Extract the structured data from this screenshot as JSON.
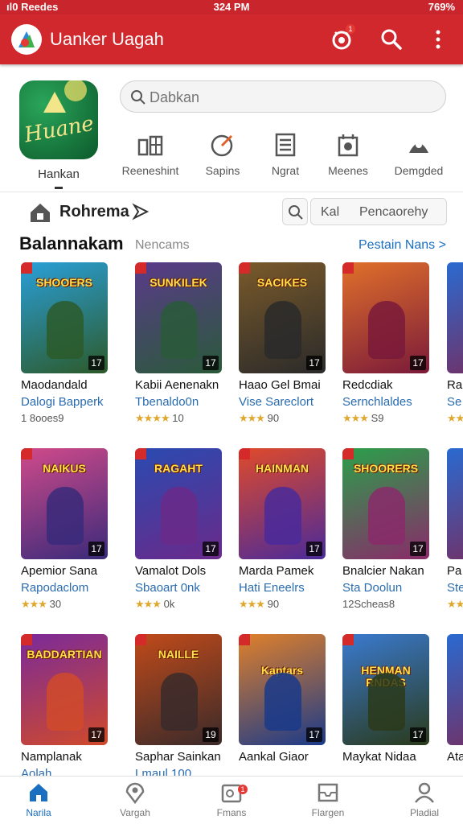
{
  "status_bar": {
    "left": "ıl0 Reedes",
    "time": "324 PM",
    "battery": "769%"
  },
  "app_bar": {
    "title": "Uanker Uagah",
    "notif_count": "1"
  },
  "featured": {
    "label": "Hankan",
    "icon_text": "Huane"
  },
  "search": {
    "placeholder": "Dabkan"
  },
  "categories": [
    {
      "label": "Reeneshint",
      "icon": "grid-book-icon"
    },
    {
      "label": "Sapins",
      "icon": "target-icon"
    },
    {
      "label": "Ngrat",
      "icon": "list-doc-icon"
    },
    {
      "label": "Meenes",
      "icon": "puzzle-icon"
    },
    {
      "label": "Demgded",
      "icon": "robot-icon"
    }
  ],
  "section": {
    "name": "Rohrema",
    "filter_a": "Kal",
    "filter_b": "Pencaorehy"
  },
  "list": {
    "title": "Balannakam",
    "subtitle": "Nencams",
    "link": "Pestain Nans >"
  },
  "games": [
    {
      "title": "Maodandald",
      "publisher": "Dalogi Bapperk",
      "rating": "1 8ooes9",
      "stars": "",
      "art_title": "SHOOERS",
      "age": "17",
      "c1": "#2a9fd8",
      "c2": "#2c5a2a"
    },
    {
      "title": "Kabii Aenenakn",
      "publisher": "Tbenaldo0n",
      "rating": "10",
      "stars": "★★★★",
      "art_title": "SUNKILEK",
      "age": "17",
      "c1": "#5a3a8a",
      "c2": "#2a5a3a"
    },
    {
      "title": "Haao Gel Bmai",
      "publisher": "Vise Sareclort",
      "rating": "90",
      "stars": "★★★",
      "art_title": "SACIKES",
      "age": "17",
      "c1": "#7a5a2a",
      "c2": "#2a2a2a"
    },
    {
      "title": "Redcdiak",
      "publisher": "Sernchlaldes",
      "rating": "S9",
      "stars": "★★★",
      "art_title": "",
      "age": "17",
      "c1": "#e0702a",
      "c2": "#7a1a3a"
    },
    {
      "title": "Apemior Sana",
      "publisher": "Rapodaclom",
      "rating": "30",
      "stars": "★★★",
      "art_title": "NAIKUS",
      "age": "17",
      "c1": "#d04a8a",
      "c2": "#3a2a7a"
    },
    {
      "title": "Vamalot Dols",
      "publisher": "Sbaoart 0nk",
      "rating": "0k",
      "stars": "★★★",
      "art_title": "RAGAHT",
      "age": "17",
      "c1": "#2a4ab0",
      "c2": "#6a2a8a"
    },
    {
      "title": "Marda Pamek",
      "publisher": "Hati Eneelrs",
      "rating": "90",
      "stars": "★★★",
      "art_title": "HAINMAN",
      "age": "17",
      "c1": "#e04a2a",
      "c2": "#4a2a9a"
    },
    {
      "title": "Bnalcier Nakan",
      "publisher": "Sta Doolun",
      "rating": "12Scheas8",
      "stars": "",
      "art_title": "SHOORERS",
      "age": "17",
      "c1": "#2aa04a",
      "c2": "#8a2a6a"
    },
    {
      "title": "Namplanak",
      "publisher": "Aolah",
      "rating": "",
      "stars": "",
      "art_title": "BADDARTIAN",
      "age": "17",
      "c1": "#7a2a9a",
      "c2": "#d04a2a"
    },
    {
      "title": "Saphar Sainkan",
      "publisher": "Lmaul 100",
      "rating": "",
      "stars": "",
      "art_title": "NAILLE",
      "age": "19",
      "c1": "#c04a1a",
      "c2": "#3a2a2a"
    },
    {
      "title": "Aankal Giaor",
      "publisher": "",
      "rating": "",
      "stars": "",
      "art_title": "Kaptars",
      "age": "17",
      "c1": "#e0802a",
      "c2": "#1a3a8a"
    },
    {
      "title": "Maykat Nidaa",
      "publisher": "",
      "rating": "",
      "stars": "",
      "art_title": "HENMAN RNDAS",
      "age": "17",
      "c1": "#3a7ad0",
      "c2": "#2a3a1a"
    }
  ],
  "peek": [
    {
      "title": "Ra",
      "publisher": "Se",
      "stars": "★★"
    },
    {
      "title": "Pa",
      "publisher": "Ste",
      "stars": "★★"
    },
    {
      "title": "Ata",
      "publisher": ""
    }
  ],
  "bottom_nav": [
    {
      "label": "Narila",
      "icon": "home-icon",
      "active": true
    },
    {
      "label": "Vargah",
      "icon": "location-icon",
      "active": false
    },
    {
      "label": "Fmans",
      "icon": "calendar-icon",
      "active": false,
      "badge": "1"
    },
    {
      "label": "Flargen",
      "icon": "inbox-icon",
      "active": false
    },
    {
      "label": "Pladial",
      "icon": "profile-icon",
      "active": false
    }
  ],
  "colors": {
    "app_bar": "#d0282d",
    "link": "#1a6fc0",
    "star": "#e0a82e"
  }
}
